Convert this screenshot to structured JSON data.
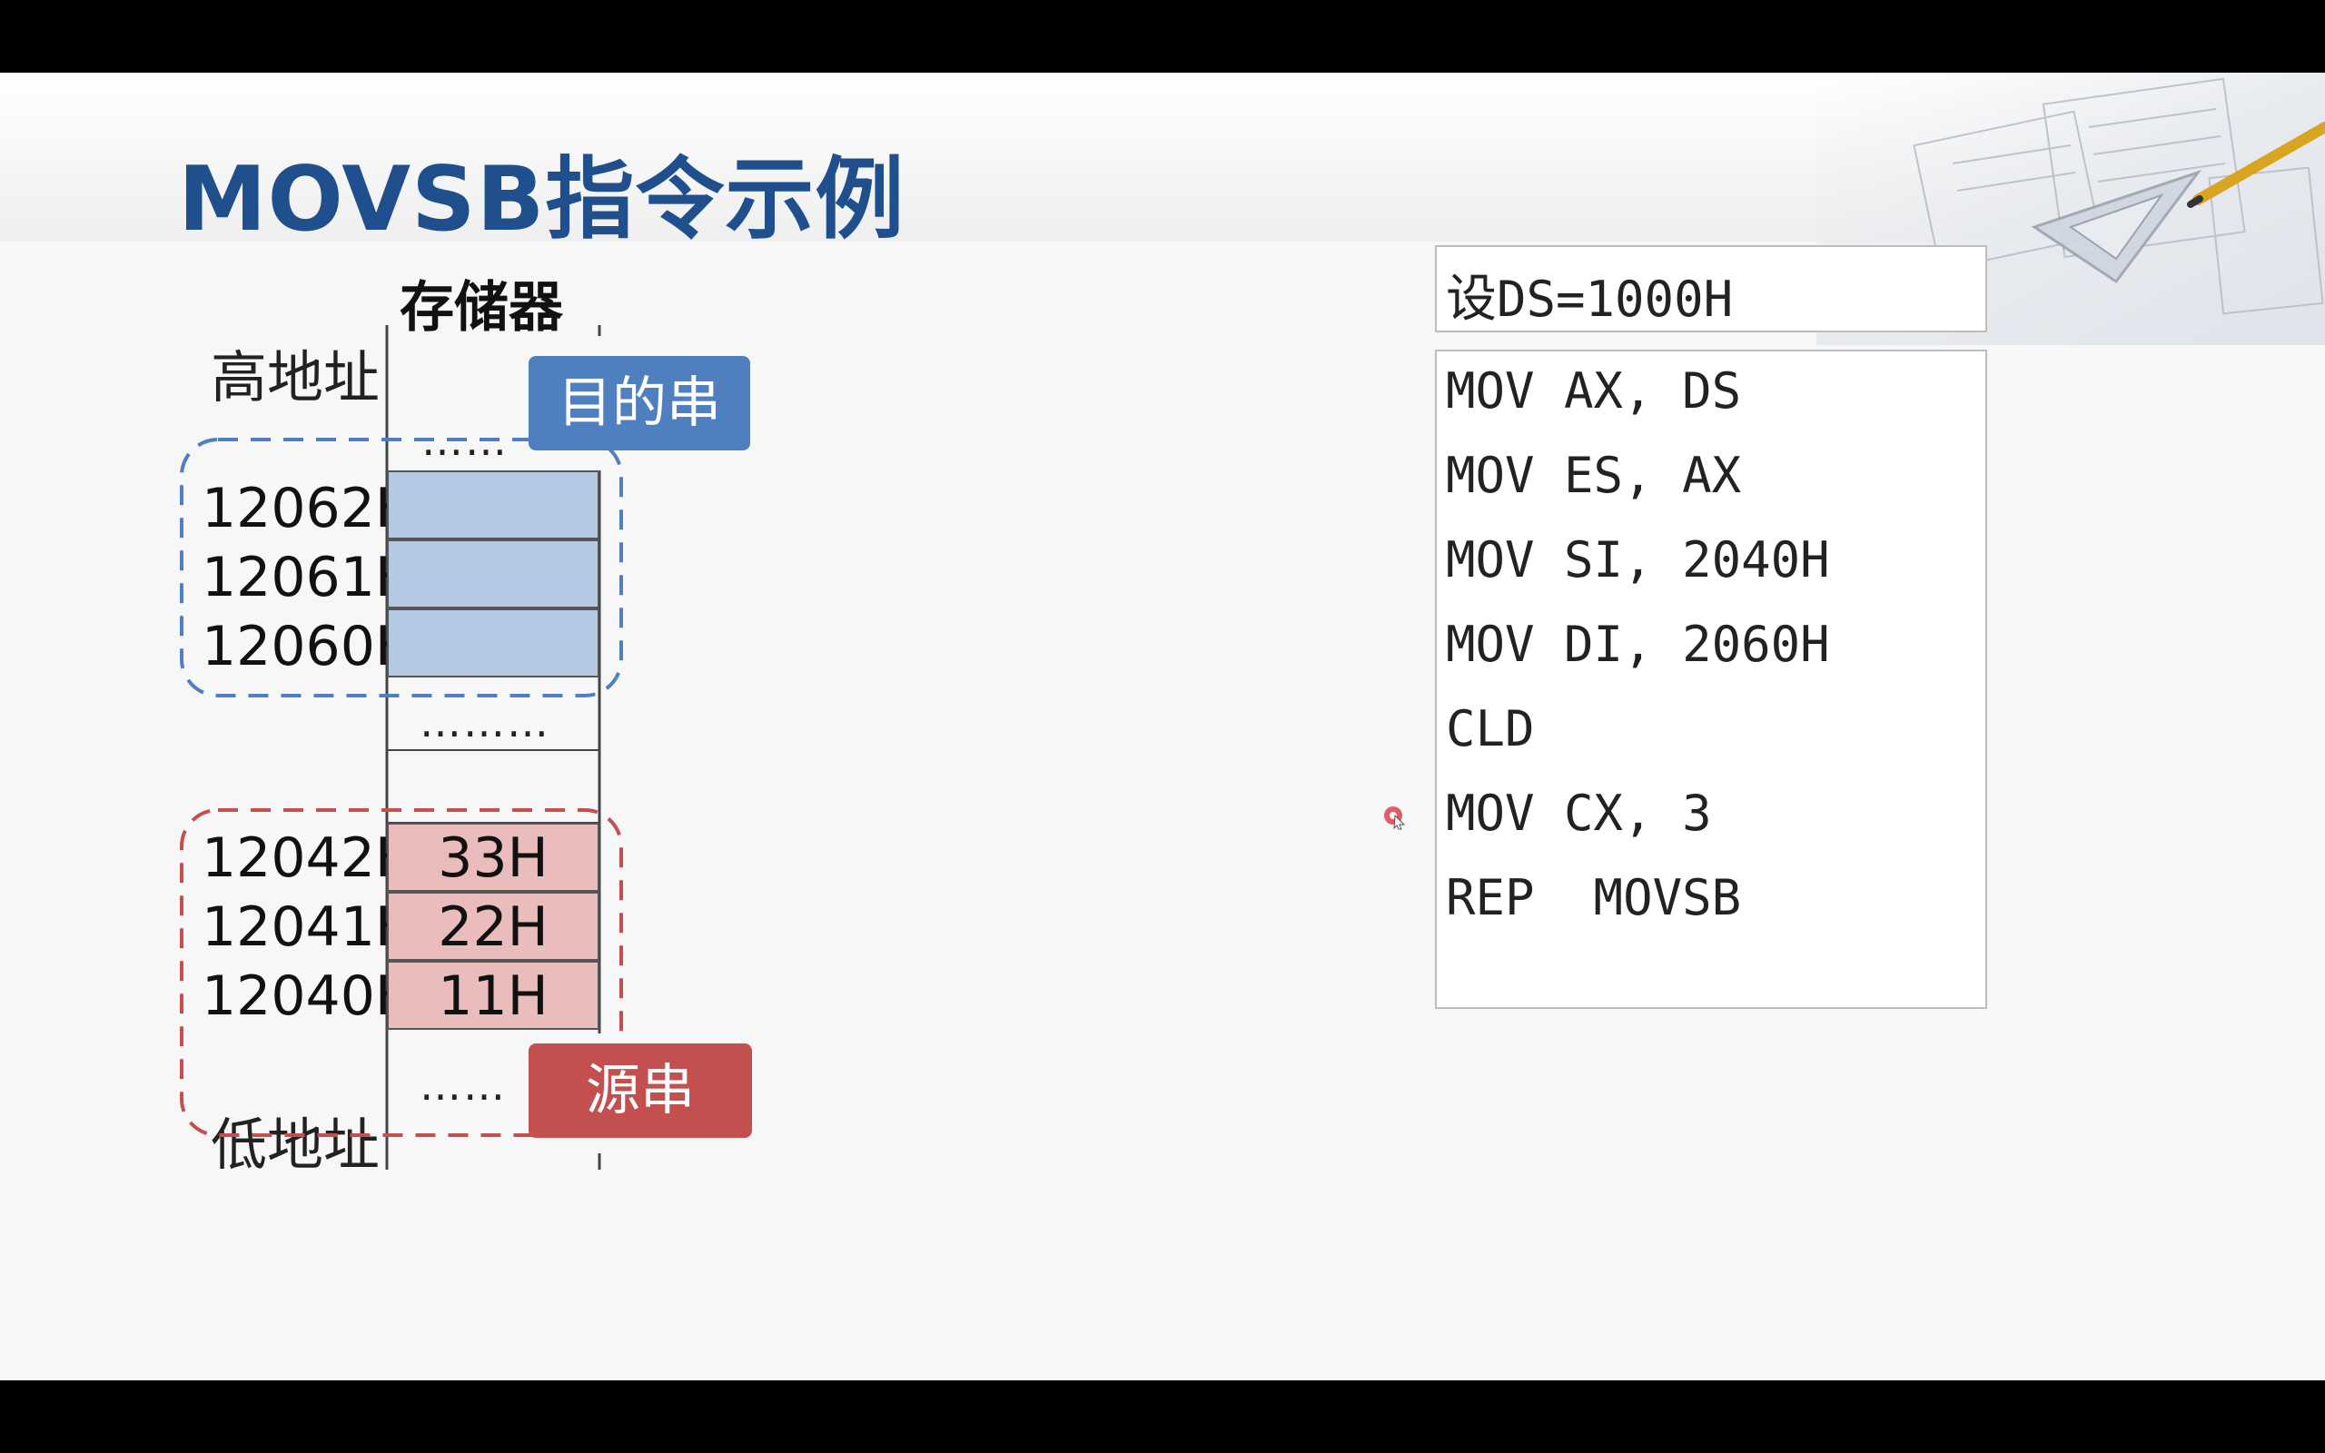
{
  "title": "MOVSB指令示例",
  "memory": {
    "label": "存储器",
    "high_address": "高地址",
    "low_address": "低地址",
    "dots": "………",
    "dots_short": "……",
    "destination": {
      "tag": "目的串",
      "rows": [
        {
          "address": "12062H",
          "value": ""
        },
        {
          "address": "12061H",
          "value": ""
        },
        {
          "address": "12060H",
          "value": ""
        }
      ]
    },
    "source": {
      "tag": "源串",
      "rows": [
        {
          "address": "12042H",
          "value": "33H"
        },
        {
          "address": "12041H",
          "value": "22H"
        },
        {
          "address": "12040H",
          "value": "11H"
        }
      ]
    }
  },
  "setup": {
    "prefix": "设",
    "text": "DS=1000H"
  },
  "code": [
    "MOV AX, DS",
    "MOV ES, AX",
    "MOV SI, 2040H",
    "MOV DI, 2060H",
    "CLD",
    "MOV CX, 3",
    "REP  MOVSB"
  ],
  "colors": {
    "title": "#1f4f8c",
    "destination_fill": "#b6c9e3",
    "destination_border": "#4f7fbe",
    "source_fill": "#ebbcbc",
    "source_border": "#c44f4f"
  }
}
